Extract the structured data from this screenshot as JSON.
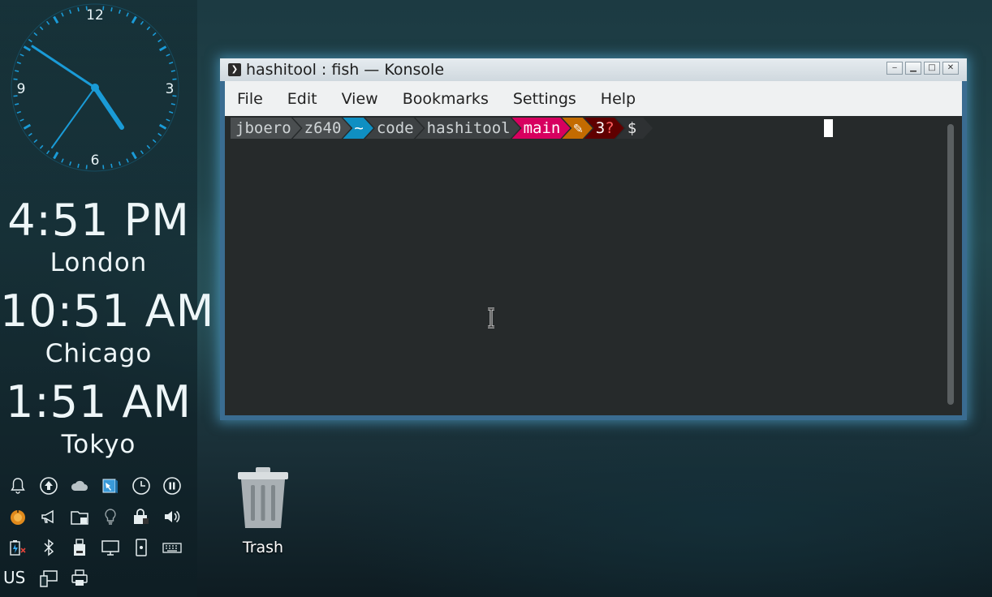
{
  "clocks": [
    {
      "time": "4:51 PM",
      "city": "London"
    },
    {
      "time": "10:51 AM",
      "city": "Chicago"
    },
    {
      "time": "1:51 AM",
      "city": "Tokyo"
    }
  ],
  "analog_clock": {
    "numerals": [
      "12",
      "3",
      "6",
      "9"
    ]
  },
  "keyboard_layout": "US",
  "window": {
    "title": "hashitool : fish — Konsole",
    "menu": [
      "File",
      "Edit",
      "View",
      "Bookmarks",
      "Settings",
      "Help"
    ]
  },
  "prompt": {
    "user": "jboero",
    "host": "z640",
    "home": "~",
    "dir1": "code",
    "dir2": "hashitool",
    "branch": "main",
    "dirty": "✎",
    "untracked": "3",
    "untracked_mark": "?",
    "symbol": "$"
  },
  "desktop": {
    "trash_label": "Trash"
  },
  "colors": {
    "accent": "#1a9bd7",
    "prompt_user_bg": "#4a4e50",
    "prompt_home_bg": "#0f8fc2",
    "prompt_branch_bg": "#d7005f",
    "prompt_dirty_bg": "#c36b00",
    "prompt_untracked_bg": "#5f0000",
    "prompt_untracked_fg": "#ff5f5f",
    "terminal_bg": "#262a2b"
  },
  "tray_icons": [
    "notification-bell-icon",
    "update-arrow-icon",
    "weather-cloud-icon",
    "desktop-cube-icon",
    "clock-icon",
    "pause-icon",
    "pumpkin-icon",
    "megaphone-icon",
    "folder-storage-icon",
    "lightbulb-icon",
    "vault-lock-icon",
    "speaker-icon",
    "battery-charging-icon",
    "bluetooth-icon",
    "usb-drive-icon",
    "display-monitor-icon",
    "phone-device-icon",
    "keyboard-icon",
    "network-monitor-icon",
    "printer-icon"
  ]
}
